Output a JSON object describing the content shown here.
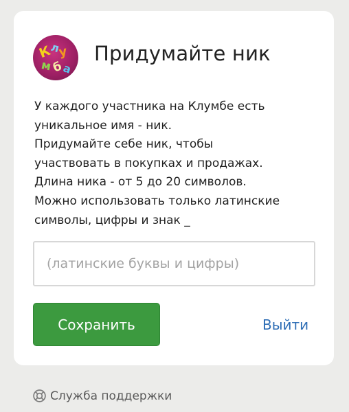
{
  "page": {
    "title": "Придумайте ник",
    "description_lines": [
      "У каждого участника на Клумбе есть",
      "уникальное имя - ник.",
      "Придумайте себе ник, чтобы",
      "участвовать в покупках и продажах.",
      "Длина ника - от 5 до 20 символов.",
      "Можно использовать только латинские",
      "символы, цифры и знак _"
    ]
  },
  "logo": {
    "icon": "klumba-logo-icon",
    "text": "Клумба"
  },
  "form": {
    "nick_value": "",
    "nick_placeholder": "(латинские буквы и цифры)",
    "save_label": "Сохранить",
    "logout_label": "Выйти"
  },
  "footer": {
    "support_icon": "lifebuoy-icon",
    "support_label": "Служба поддержки"
  },
  "colors": {
    "background": "#ececea",
    "card": "#ffffff",
    "save_button": "#3c9a3f",
    "link": "#2d6db5",
    "logo": "#b02a70"
  }
}
